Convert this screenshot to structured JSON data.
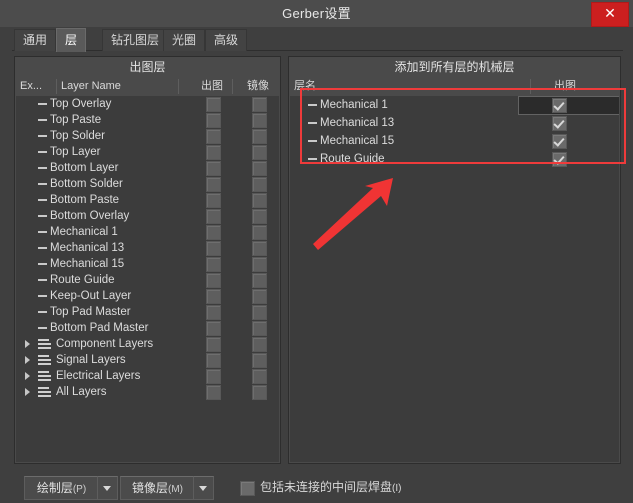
{
  "window": {
    "title": "Gerber设置",
    "close_label": "✕"
  },
  "tabs": [
    {
      "label": "通用",
      "active": false
    },
    {
      "label": "层",
      "active": true
    },
    {
      "label": "钻孔图层",
      "active": false
    },
    {
      "label": "光圈",
      "active": false
    },
    {
      "label": "高级",
      "active": false
    }
  ],
  "left_panel": {
    "title": "出图层",
    "columns": [
      "Ex...",
      "Layer Name",
      "出图",
      "镜像"
    ],
    "rows": [
      {
        "label": "Top Overlay",
        "type": "layer",
        "plot": false,
        "mirror": false
      },
      {
        "label": "Top Paste",
        "type": "layer",
        "plot": false,
        "mirror": false
      },
      {
        "label": "Top Solder",
        "type": "layer",
        "plot": false,
        "mirror": false
      },
      {
        "label": "Top Layer",
        "type": "layer",
        "plot": false,
        "mirror": false
      },
      {
        "label": "Bottom Layer",
        "type": "layer",
        "plot": false,
        "mirror": false
      },
      {
        "label": "Bottom Solder",
        "type": "layer",
        "plot": false,
        "mirror": false
      },
      {
        "label": "Bottom Paste",
        "type": "layer",
        "plot": false,
        "mirror": false
      },
      {
        "label": "Bottom Overlay",
        "type": "layer",
        "plot": false,
        "mirror": false
      },
      {
        "label": "Mechanical 1",
        "type": "layer",
        "plot": false,
        "mirror": false
      },
      {
        "label": "Mechanical 13",
        "type": "layer",
        "plot": false,
        "mirror": false
      },
      {
        "label": "Mechanical 15",
        "type": "layer",
        "plot": false,
        "mirror": false
      },
      {
        "label": "Route Guide",
        "type": "layer",
        "plot": false,
        "mirror": false
      },
      {
        "label": "Keep-Out Layer",
        "type": "layer",
        "plot": false,
        "mirror": false
      },
      {
        "label": "Top Pad Master",
        "type": "layer",
        "plot": false,
        "mirror": false
      },
      {
        "label": "Bottom Pad Master",
        "type": "layer",
        "plot": false,
        "mirror": false
      },
      {
        "label": "Component Layers",
        "type": "group",
        "plot": false,
        "mirror": false
      },
      {
        "label": "Signal Layers",
        "type": "group",
        "plot": false,
        "mirror": false
      },
      {
        "label": "Electrical Layers",
        "type": "group",
        "plot": false,
        "mirror": false
      },
      {
        "label": "All Layers",
        "type": "group",
        "plot": false,
        "mirror": false
      }
    ]
  },
  "right_panel": {
    "title": "添加到所有层的机械层",
    "columns": [
      "层名",
      "出图"
    ],
    "rows": [
      {
        "label": "Mechanical 1",
        "plot": true,
        "editing": true
      },
      {
        "label": "Mechanical 13",
        "plot": true,
        "editing": false
      },
      {
        "label": "Mechanical 15",
        "plot": true,
        "editing": false
      },
      {
        "label": "Route Guide",
        "plot": true,
        "editing": false
      }
    ]
  },
  "footer": {
    "plot_layers_button": "绘制层",
    "plot_layers_accel": "(P)",
    "mirror_layers_button": "镜像层",
    "mirror_layers_accel": "(M)",
    "include_unconnected_label": "包括未连接的中间层焊盘",
    "include_unconnected_accel": "(I)",
    "include_unconnected_checked": false
  },
  "annotations": {
    "highlight_color": "#ef3b3b",
    "arrow_color": "#f03434"
  }
}
